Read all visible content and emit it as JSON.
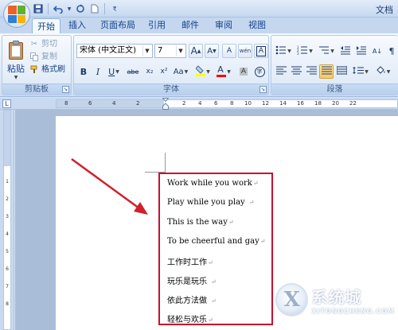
{
  "window": {
    "title": "文档"
  },
  "quick_access": {
    "save_icon": "save-icon",
    "undo_icon": "undo-icon",
    "redo_icon": "redo-icon",
    "new_icon": "new-document-icon",
    "customize_icon": "customize-dropdown-icon"
  },
  "tabs": [
    {
      "label": "开始",
      "active": true
    },
    {
      "label": "插入",
      "active": false
    },
    {
      "label": "页面布局",
      "active": false
    },
    {
      "label": "引用",
      "active": false
    },
    {
      "label": "邮件",
      "active": false
    },
    {
      "label": "审阅",
      "active": false
    },
    {
      "label": "视图",
      "active": false
    }
  ],
  "ribbon": {
    "clipboard": {
      "group_label": "剪贴板",
      "paste_label": "粘贴",
      "cut_label": "剪切",
      "copy_label": "复制",
      "format_painter_label": "格式刷"
    },
    "font": {
      "group_label": "字体",
      "font_name": "宋体 (中文正文)",
      "font_size": "7",
      "bold": "B",
      "italic": "I",
      "underline": "U",
      "strike": "abe",
      "subscript": "x₂",
      "superscript": "x²",
      "change_case": "Aa",
      "grow": "A",
      "shrink": "A",
      "font_color": "A",
      "clear_format": "A",
      "phonetic": "wén",
      "char_border": "A",
      "enclose": "字",
      "highlight_color": "#ffff00",
      "font_color_value": "#ff0000"
    },
    "paragraph": {
      "group_label": "段落"
    }
  },
  "ruler": {
    "tab_selector": "L",
    "h_numbers": [
      "8",
      "6",
      "4",
      "2",
      "2",
      "4",
      "6",
      "8",
      "10",
      "12",
      "14",
      "16",
      "18",
      "20",
      "22"
    ],
    "v_numbers": [
      "1",
      "2",
      "3",
      "4",
      "5",
      "6",
      "7",
      "8"
    ]
  },
  "document": {
    "lines": [
      "Work while you work",
      "Play while you play",
      "This is the way",
      "To be cheerful and gay",
      "工作时工作",
      "玩乐是玩乐",
      "依此方法做",
      "轻松与欢乐"
    ],
    "paragraph_mark": "↵"
  },
  "annotation": {
    "box_color": "#c8102e",
    "arrow_color": "#d21f2a"
  },
  "watermark": {
    "cn": "系统城",
    "en": "XITONGCHENG.COM",
    "logo_letter": "X"
  }
}
